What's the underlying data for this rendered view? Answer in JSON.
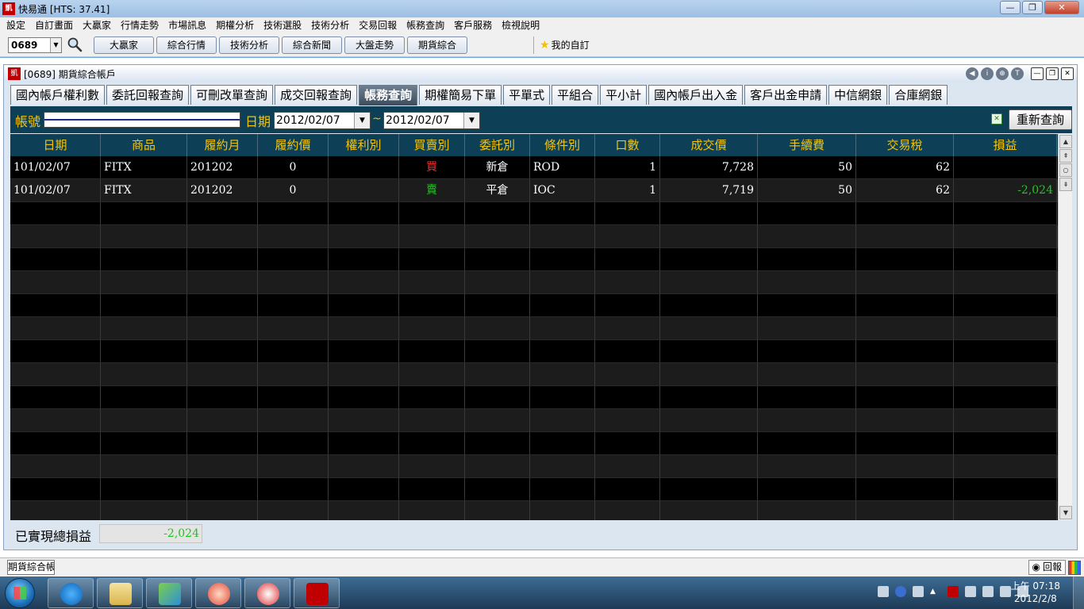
{
  "window": {
    "title": "快易通  [HTS: 37.41]",
    "logo_text": "凱"
  },
  "menu": [
    "設定",
    "自訂畫面",
    "大贏家",
    "行情走勢",
    "市場訊息",
    "期權分析",
    "技術選股",
    "技術分析",
    "交易回報",
    "帳務查詢",
    "客戶服務",
    "檢視說明"
  ],
  "toolbar": {
    "code_value": "0689",
    "buttons": [
      "大贏家",
      "綜合行情",
      "技術分析",
      "綜合新聞",
      "大盤走勢",
      "期貨綜合"
    ],
    "favorite_label": "我的自訂"
  },
  "child": {
    "title": "[0689] 期貨綜合帳戶",
    "logo_text": "凱",
    "controls": [
      "◀",
      "i",
      "⊕",
      "T"
    ]
  },
  "tabs": [
    "國內帳戶權利數",
    "委託回報查詢",
    "可刪改單查詢",
    "成交回報查詢",
    "帳務查詢",
    "期權簡易下單",
    "平單式",
    "平組合",
    "平小計",
    "國內帳戶出入金",
    "客戶出金申請",
    "中信網銀",
    "合庫網銀"
  ],
  "active_tab": "帳務查詢",
  "query": {
    "account_label": "帳號",
    "date_label": "日期",
    "date_from": "2012/02/07",
    "date_to": "2012/02/07",
    "tilde": "~",
    "requery_label": "重新查詢"
  },
  "table": {
    "headers": [
      "日期",
      "商品",
      "履約月",
      "履約價",
      "權利別",
      "買賣別",
      "委託別",
      "條件別",
      "口數",
      "成交價",
      "手續費",
      "交易稅",
      "損益"
    ],
    "rows": [
      {
        "date": "101/02/07",
        "product": "FITX",
        "month": "201202",
        "strike": "0",
        "right": "",
        "side": "買",
        "order_type": "新倉",
        "condition": "ROD",
        "qty": "1",
        "price": "7,728",
        "fee": "50",
        "tax": "62",
        "pnl": ""
      },
      {
        "date": "101/02/07",
        "product": "FITX",
        "month": "201202",
        "strike": "0",
        "right": "",
        "side": "賣",
        "order_type": "平倉",
        "condition": "IOC",
        "qty": "1",
        "price": "7,719",
        "fee": "50",
        "tax": "62",
        "pnl": "-2,024"
      }
    ],
    "empty_rows": 14,
    "colors": {
      "buy": "#ff2a2a",
      "sell": "#21c821",
      "header_text": "#f3c40c",
      "header_bg": "#0d3f57"
    }
  },
  "summary": {
    "label": "已實現總損益",
    "value": "-2,024"
  },
  "status": {
    "tab_label": "期貨綜合帳戶",
    "huibao_label": "回報"
  },
  "clock": {
    "time": "上午 07:18",
    "date": "2012/2/8"
  }
}
